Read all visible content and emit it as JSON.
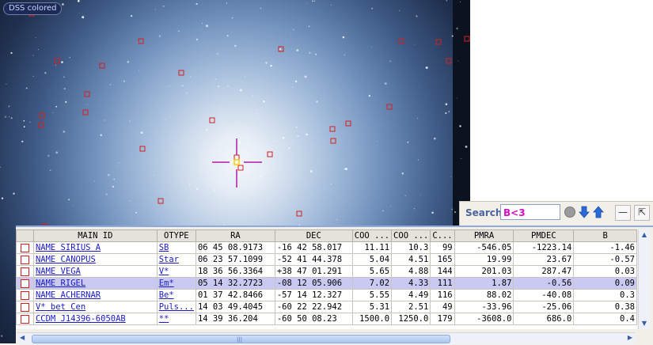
{
  "viewer": {
    "survey_label": "DSS colored"
  },
  "search": {
    "label": "Search",
    "value": "B<3"
  },
  "window_controls": {
    "minimize": "—",
    "popout": "⇱"
  },
  "table": {
    "columns": [
      "MAIN ID",
      "OTYPE",
      "RA",
      "DEC",
      "COO ...",
      "COO ...",
      "C...",
      "PMRA",
      "PMDEC",
      "B"
    ],
    "rows": [
      {
        "main_id": "NAME SIRIUS A",
        "otype": "SB",
        "ra": "06 45 08.9173",
        "dec": "-16 42 58.017",
        "coo1": "11.11",
        "coo2": "10.3",
        "c": "99",
        "pmra": "-546.05",
        "pmdec": "-1223.14",
        "b": "-1.46"
      },
      {
        "main_id": "NAME CANOPUS",
        "otype": "Star",
        "ra": "06 23 57.1099",
        "dec": "-52 41 44.378",
        "coo1": "5.04",
        "coo2": "4.51",
        "c": "165",
        "pmra": "19.99",
        "pmdec": "23.67",
        "b": "-0.57"
      },
      {
        "main_id": "NAME VEGA",
        "otype": "V*",
        "ra": "18 36 56.3364",
        "dec": "+38 47 01.291",
        "coo1": "5.65",
        "coo2": "4.88",
        "c": "144",
        "pmra": "201.03",
        "pmdec": "287.47",
        "b": "0.03"
      },
      {
        "main_id": "NAME RIGEL",
        "otype": "Em*",
        "ra": "05 14 32.2723",
        "dec": "-08 12 05.906",
        "coo1": "7.02",
        "coo2": "4.33",
        "c": "111",
        "pmra": "1.87",
        "pmdec": "-0.56",
        "b": "0.09"
      },
      {
        "main_id": "NAME ACHERNAR",
        "otype": "Be*",
        "ra": "01 37 42.8466",
        "dec": "-57 14 12.327",
        "coo1": "5.55",
        "coo2": "4.49",
        "c": "116",
        "pmra": "88.02",
        "pmdec": "-40.08",
        "b": "0.3"
      },
      {
        "main_id": "V* bet Cen",
        "otype": "Puls...",
        "ra": "14 03 49.4045",
        "dec": "-60 22 22.942",
        "coo1": "5.31",
        "coo2": "2.51",
        "c": "49",
        "pmra": "-33.96",
        "pmdec": "-25.06",
        "b": "0.38"
      },
      {
        "main_id": "CCDM J14396-6050AB",
        "otype": "**",
        "ra": "14 39 36.204",
        "dec": "-60 50 08.23",
        "coo1": "1500.0",
        "coo2": "1250.0",
        "c": "179",
        "pmra": "-3608.0",
        "pmdec": "686.0",
        "b": "0.4"
      }
    ]
  },
  "colors": {
    "marker": "#d42020",
    "crosshair": "#b01aa8",
    "search_text": "#d010c0",
    "selected_row": "#c9c9f4",
    "link": "#1a1ac8"
  },
  "icons": [
    "circle-icon",
    "arrow-down-icon",
    "arrow-up-icon",
    "minimize-icon",
    "popout-icon",
    "checkbox-icon"
  ]
}
